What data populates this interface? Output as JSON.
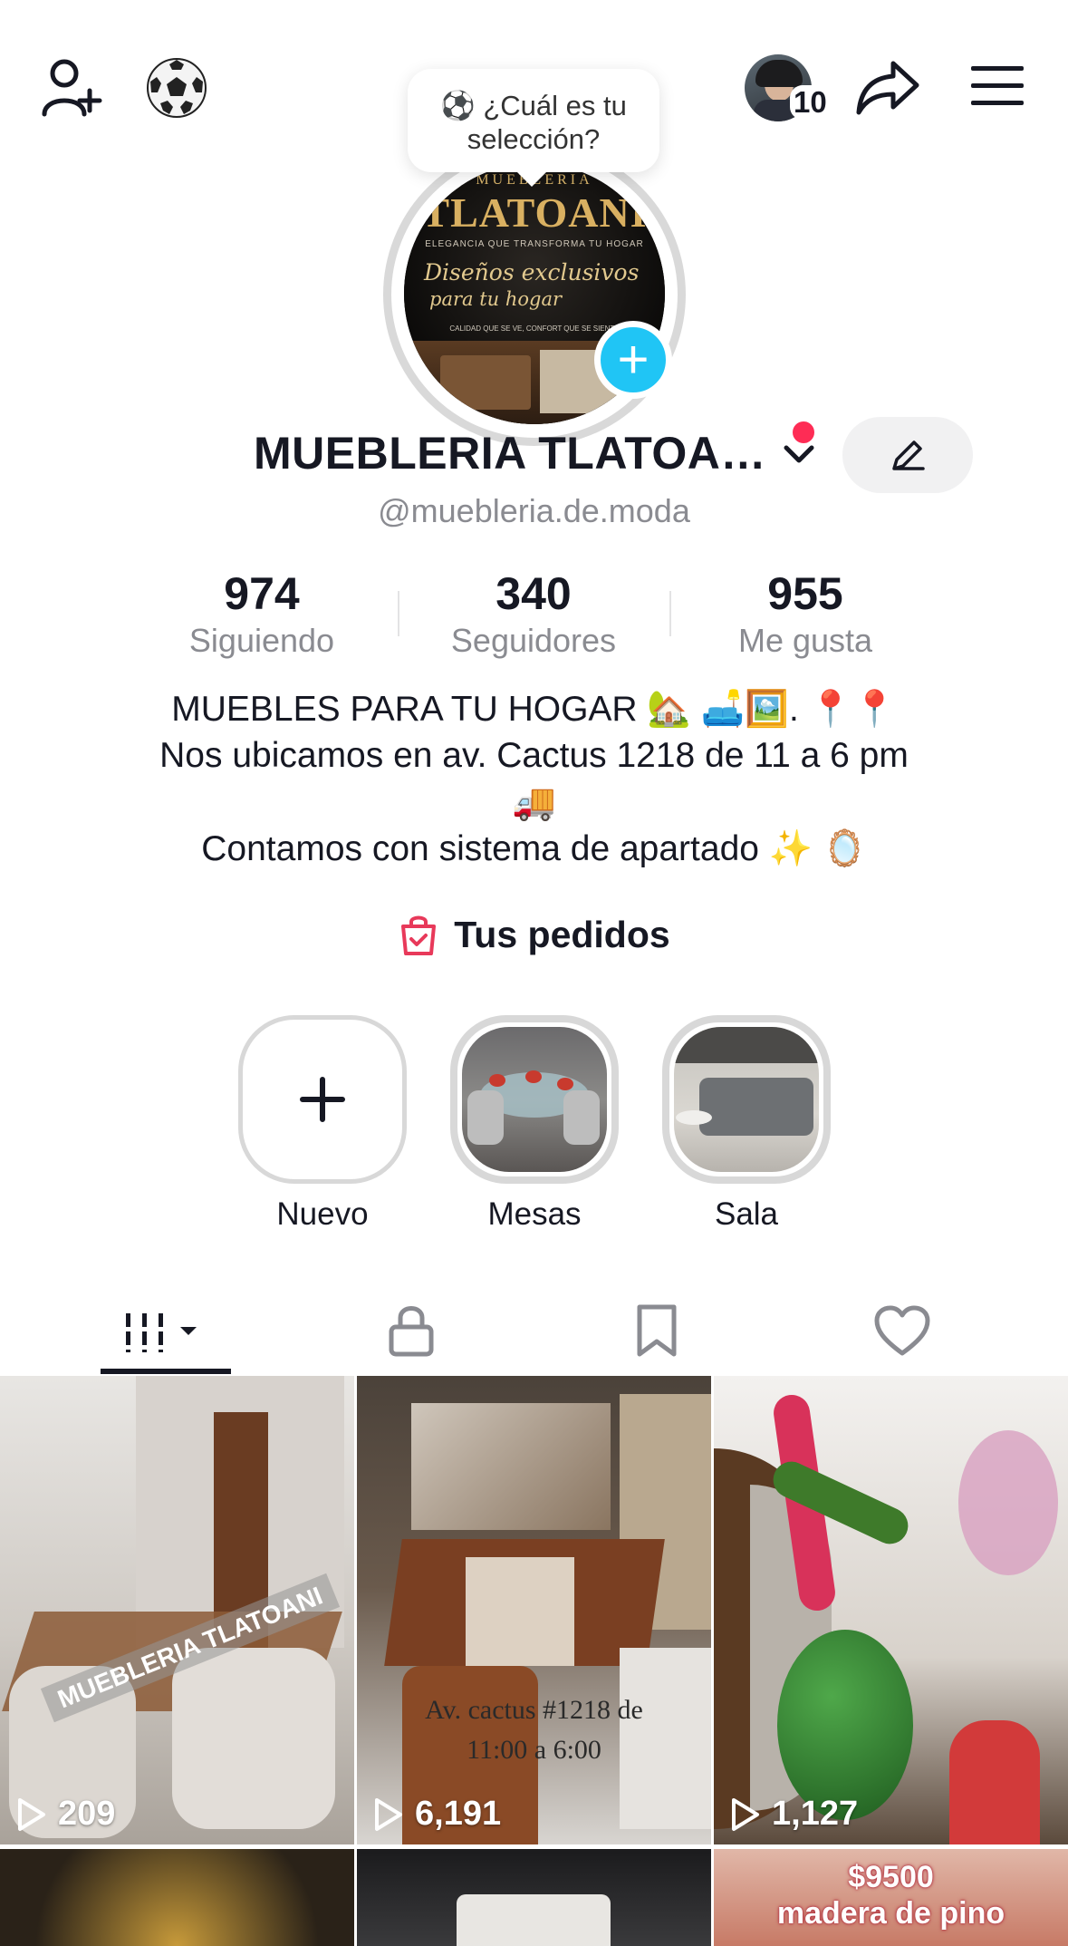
{
  "top_bar": {
    "add_friend_icon": "person-plus-icon",
    "soccer_icon": "soccer-ball-icon",
    "visitors_count": "10",
    "share_icon": "share-arrow-icon",
    "menu_icon": "hamburger-menu-icon"
  },
  "prompt_bubble": {
    "emoji": "⚽",
    "text_line1": "¿Cuál es tu",
    "text_line2": "selección?"
  },
  "profile": {
    "avatar_brand": "MUEBLERIA",
    "avatar_title": "TLATOANI",
    "avatar_tagline": "ELEGANCIA QUE TRANSFORMA TU HOGAR",
    "avatar_script1": "Diseños exclusivos",
    "avatar_script2": "para tu hogar",
    "avatar_footer": "CALIDAD QUE SE VE, CONFORT QUE SE SIENTE",
    "name": "MUEBLERIA TLATOA…",
    "handle": "@muebleria.de.moda"
  },
  "stats": [
    {
      "value": "974",
      "label": "Siguiendo"
    },
    {
      "value": "340",
      "label": "Seguidores"
    },
    {
      "value": "955",
      "label": "Me gusta"
    }
  ],
  "bio": {
    "line1": "MUEBLES PARA TU HOGAR 🏡 🛋️🖼️.   📍📍",
    "line2": "Nos ubicamos en av. Cactus 1218 de 11 a 6 pm",
    "line3": "🚚",
    "line4": "Contamos con sistema de apartado ✨ 🪞"
  },
  "orders_label": "Tus pedidos",
  "highlights": [
    {
      "label": "Nuevo"
    },
    {
      "label": "Mesas"
    },
    {
      "label": "Sala"
    }
  ],
  "tabs": [
    "videos-grid",
    "private",
    "saved",
    "liked"
  ],
  "videos": [
    {
      "views": "209",
      "overlay": "MUEBLERIA TLATOANI"
    },
    {
      "views": "6,191",
      "overlay_line1": "Av. cactus #1218 de",
      "overlay_line2": "11:00 a 6:00"
    },
    {
      "views": "1,127"
    }
  ],
  "bottom_row": {
    "price": "$9500",
    "material": "madera de pino"
  },
  "colors": {
    "accent_blue": "#20c5f5",
    "notif_red": "#fe2c55",
    "text": "#161823",
    "muted": "#8a8b91"
  }
}
